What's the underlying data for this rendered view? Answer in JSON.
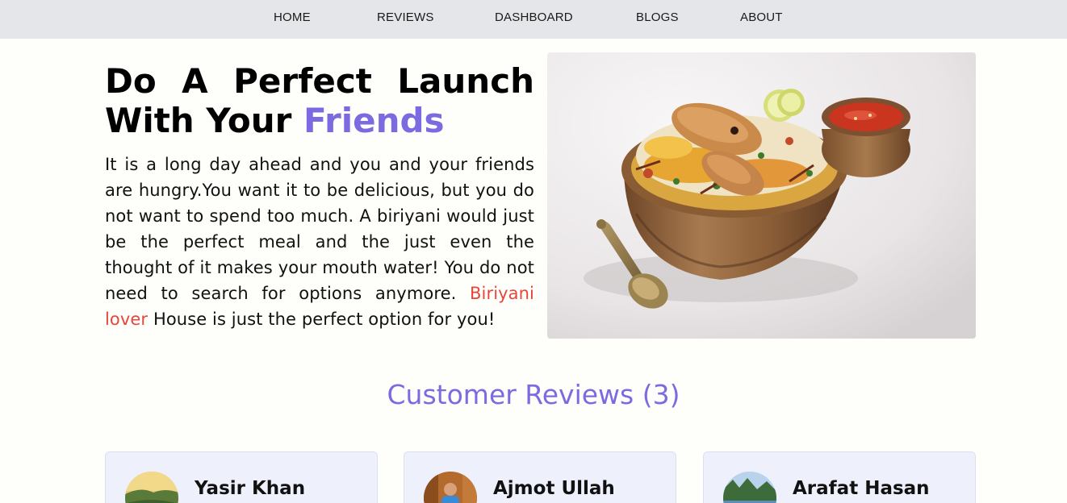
{
  "nav": {
    "items": [
      {
        "label": "HOME"
      },
      {
        "label": "REVIEWS"
      },
      {
        "label": "DASHBOARD"
      },
      {
        "label": "BLOGS"
      },
      {
        "label": "ABOUT"
      }
    ]
  },
  "hero": {
    "title_line1": "Do A Perfect Launch",
    "title_line2_prefix": "With Your",
    "title_line2_accent": "Friends",
    "body_before": "It is a long day ahead and you and your friends are hungry.You want it to be delicious, but you do not want to spend too much. A biriyani would just be the perfect meal and the just even the thought of it makes your mouth water! You do not need to search for options anymore. ",
    "body_highlight": "Biriyani lover",
    "body_after": " House is just the perfect option for you!"
  },
  "reviews": {
    "title": "Customer Reviews (3)",
    "items": [
      {
        "name": "Yasir Khan"
      },
      {
        "name": "Ajmot Ullah"
      },
      {
        "name": "Arafat Hasan"
      }
    ]
  },
  "colors": {
    "accent": "#7b6ae0",
    "highlight": "#e8453c",
    "nav_bg": "#e5e6e9",
    "card_bg": "#eef0fb"
  }
}
